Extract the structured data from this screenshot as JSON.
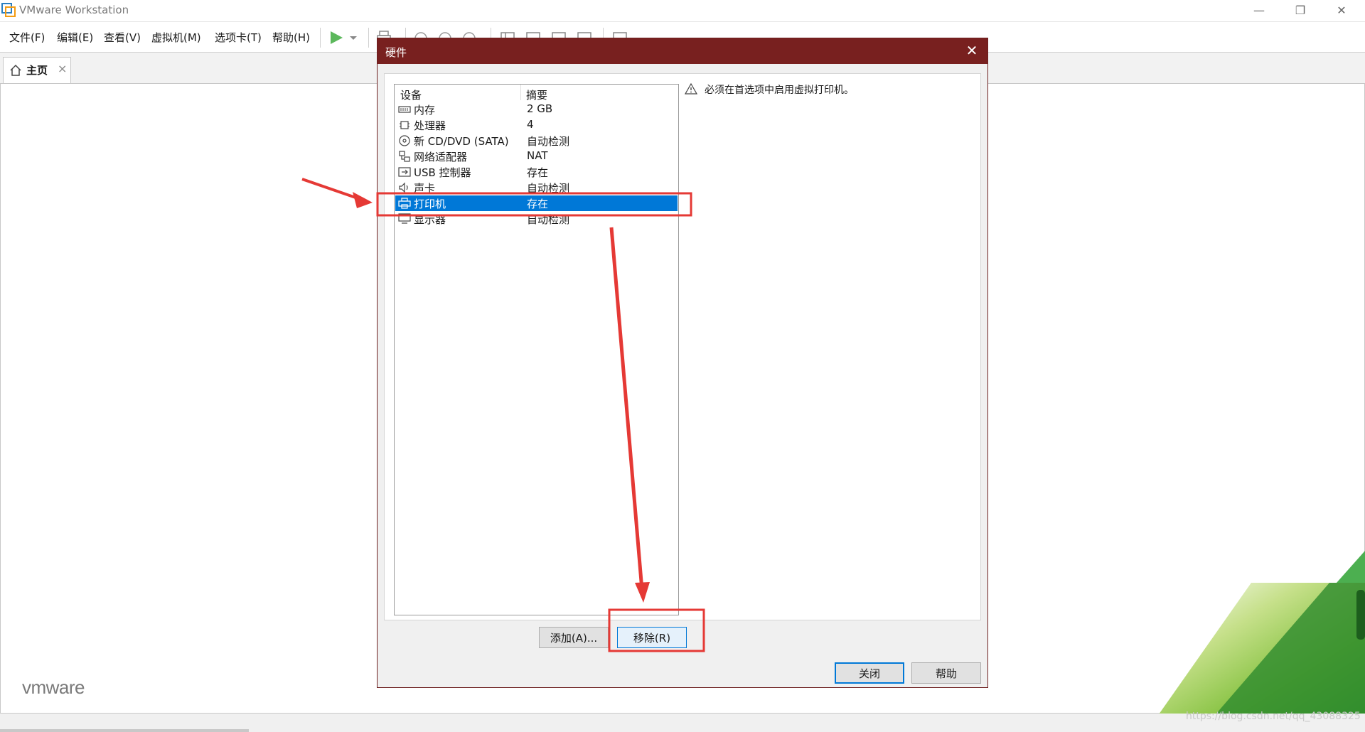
{
  "window": {
    "title": "VMware Workstation",
    "minimize_glyph": "—",
    "restore_glyph": "❐",
    "close_glyph": "✕"
  },
  "menu": [
    {
      "label": "文件(F)"
    },
    {
      "label": "编辑(E)"
    },
    {
      "label": "查看(V)"
    },
    {
      "label": "虚拟机(M)"
    },
    {
      "label": "选项卡(T)"
    },
    {
      "label": "帮助(H)"
    }
  ],
  "tabs": {
    "home_label": "主页",
    "close_glyph": "×"
  },
  "brand": {
    "logo_text": "vmware",
    "watermark": "https://blog.csdn.net/qq_43088325"
  },
  "dialog": {
    "title": "硬件",
    "close_glyph": "✕",
    "columns": {
      "device": "设备",
      "summary": "摘要"
    },
    "devices": [
      {
        "name": "内存",
        "summary": "2 GB",
        "icon": "memory-icon"
      },
      {
        "name": "处理器",
        "summary": "4",
        "icon": "processor-icon"
      },
      {
        "name": "新 CD/DVD (SATA)",
        "summary": "自动检测",
        "icon": "cd-dvd-icon"
      },
      {
        "name": "网络适配器",
        "summary": "NAT",
        "icon": "network-adapter-icon"
      },
      {
        "name": "USB 控制器",
        "summary": "存在",
        "icon": "usb-icon"
      },
      {
        "name": "声卡",
        "summary": "自动检测",
        "icon": "speaker-icon"
      },
      {
        "name": "打印机",
        "summary": "存在",
        "icon": "printer-icon",
        "selected": true
      },
      {
        "name": "显示器",
        "summary": "自动检测",
        "icon": "monitor-icon"
      }
    ],
    "warning": "必须在首选项中启用虚拟打印机。",
    "buttons": {
      "add": "添加(A)...",
      "remove": "移除(R)",
      "close": "关闭",
      "help": "帮助"
    }
  },
  "colors": {
    "dialog_title_bg": "#78201f",
    "selection": "#0078d7",
    "annotation_red": "#e53935",
    "play_green": "#5cb85c"
  }
}
